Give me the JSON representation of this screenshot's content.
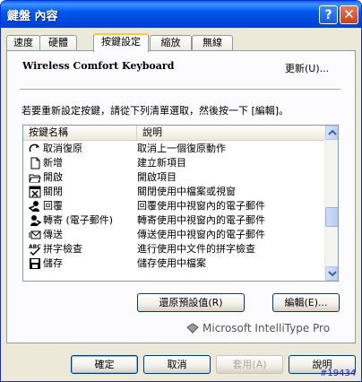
{
  "window": {
    "title": "鍵盤 內容",
    "help_label": "?",
    "close_label": "✕"
  },
  "tabs": [
    {
      "label": "速度"
    },
    {
      "label": "硬體"
    },
    {
      "label": "按鍵設定"
    },
    {
      "label": "縮放"
    },
    {
      "label": "無線"
    }
  ],
  "panel": {
    "keyboard_name": "Wireless Comfort Keyboard",
    "update_label": "更新(U)...",
    "instruction": "若要重新設定按鍵，請從下列清單選取，然後按一下 [編輯]。",
    "columns": [
      "按鍵名稱",
      "說明"
    ],
    "rows": [
      {
        "name": "取消復原",
        "desc": "取消上一個復原動作",
        "icon": "redo-icon"
      },
      {
        "name": "新增",
        "desc": "建立新項目",
        "icon": "new-document-icon"
      },
      {
        "name": "開啟",
        "desc": "開啟項目",
        "icon": "open-folder-icon"
      },
      {
        "name": "關閉",
        "desc": "關閉使用中檔案或視窗",
        "icon": "close-window-icon"
      },
      {
        "name": "回覆",
        "desc": "回覆使用中視窗內的電子郵件",
        "icon": "reply-icon"
      },
      {
        "name": "轉寄 (電子郵件)",
        "desc": "轉寄使用中視窗內的電子郵件",
        "icon": "forward-icon"
      },
      {
        "name": "傳送",
        "desc": "傳送使用中視窗內的電子郵件",
        "icon": "send-icon"
      },
      {
        "name": "拼字檢查",
        "desc": "進行使用中文件的拼字檢查",
        "icon": "spell-check-icon"
      },
      {
        "name": "儲存",
        "desc": "儲存使用中檔案",
        "icon": "save-icon"
      }
    ],
    "restore_label": "還原預設值(R)",
    "edit_label": "編輯(E)...",
    "brand": "Microsoft IntelliType Pro"
  },
  "footer": {
    "ok_label": "確定",
    "cancel_label": "取消",
    "apply_label": "套用(A)",
    "help_label": "說明"
  },
  "watermark": "#19434"
}
